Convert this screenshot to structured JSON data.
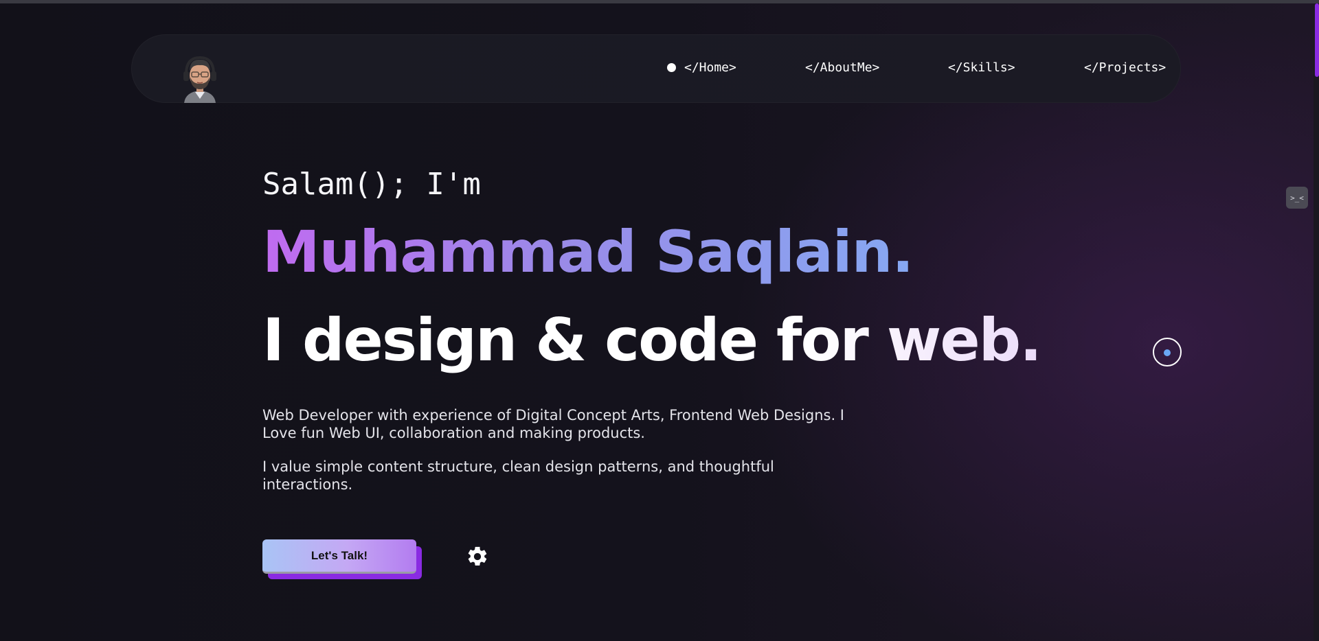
{
  "nav": {
    "items": [
      {
        "label": "</Home>",
        "active": true
      },
      {
        "label": "</AboutMe>",
        "active": false
      },
      {
        "label": "</Skills>",
        "active": false
      },
      {
        "label": "</Projects>",
        "active": false
      }
    ]
  },
  "hero": {
    "greeting": "Salam(); I'm",
    "name": "Muhammad Saqlain.",
    "tagline": "I design & code for web.",
    "paragraph1": "Web Developer with experience of Digital Concept Arts, Frontend Web Designs. I Love fun Web UI, collaboration and making products.",
    "paragraph2": "I value simple content structure, clean design patterns, and thoughtful interactions.",
    "cta_label": "Let's Talk!"
  },
  "side_toggle": {
    "label": ">_<"
  },
  "colors": {
    "accent": "#8a2be2",
    "name_gradient_start": "#c06bf0",
    "name_gradient_end": "#86a8f2",
    "cursor_dot": "#6aa8f5"
  },
  "icons": {
    "avatar": "memoji-avatar-with-headphones",
    "settings": "gear-icon"
  }
}
